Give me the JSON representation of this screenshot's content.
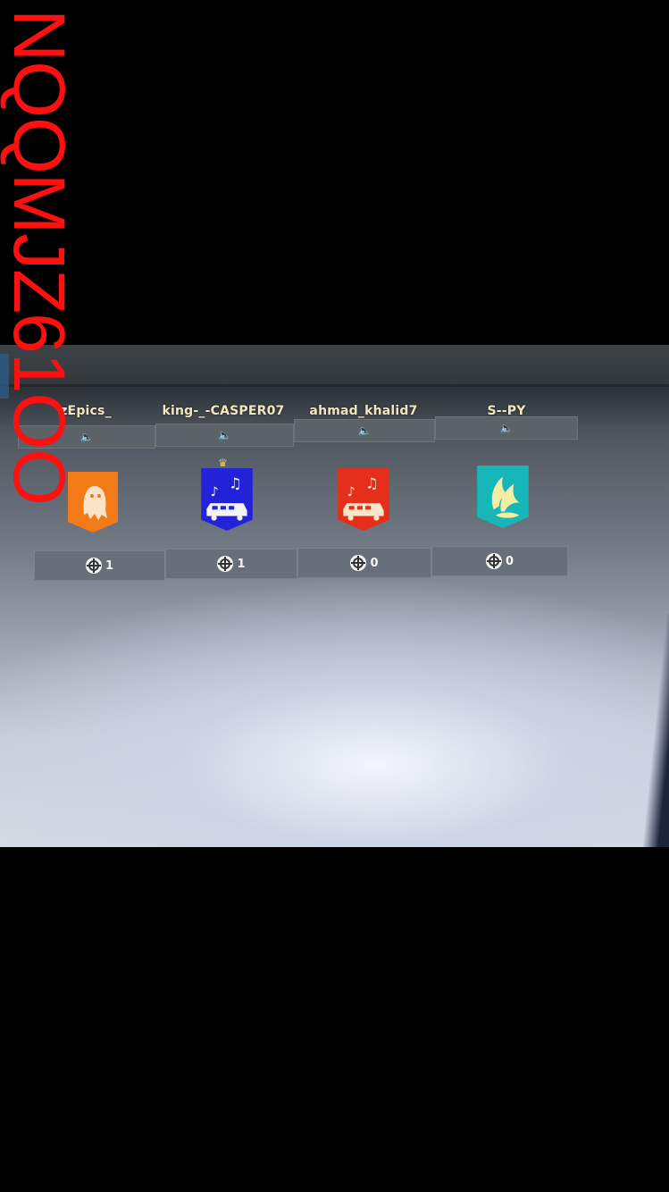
{
  "watermark": "NQQMJZ61OO",
  "players": [
    {
      "name": "zEpics_",
      "kills": "1",
      "banner": "ghost-icon",
      "banner_color": "#f47a18"
    },
    {
      "name": "king-_-CASPER07",
      "kills": "1",
      "banner": "party-bus-icon",
      "banner_color": "#2222d8",
      "leader": true
    },
    {
      "name": "ahmad_khalid7",
      "kills": "0",
      "banner": "party-bus-icon",
      "banner_color": "#e62f1a"
    },
    {
      "name": "S--PY",
      "kills": "0",
      "banner": "wings-icon",
      "banner_color": "#17b7b9"
    }
  ],
  "colors": {
    "name_text": "#f1e7bf",
    "leader_crown": "#e9c94b"
  }
}
